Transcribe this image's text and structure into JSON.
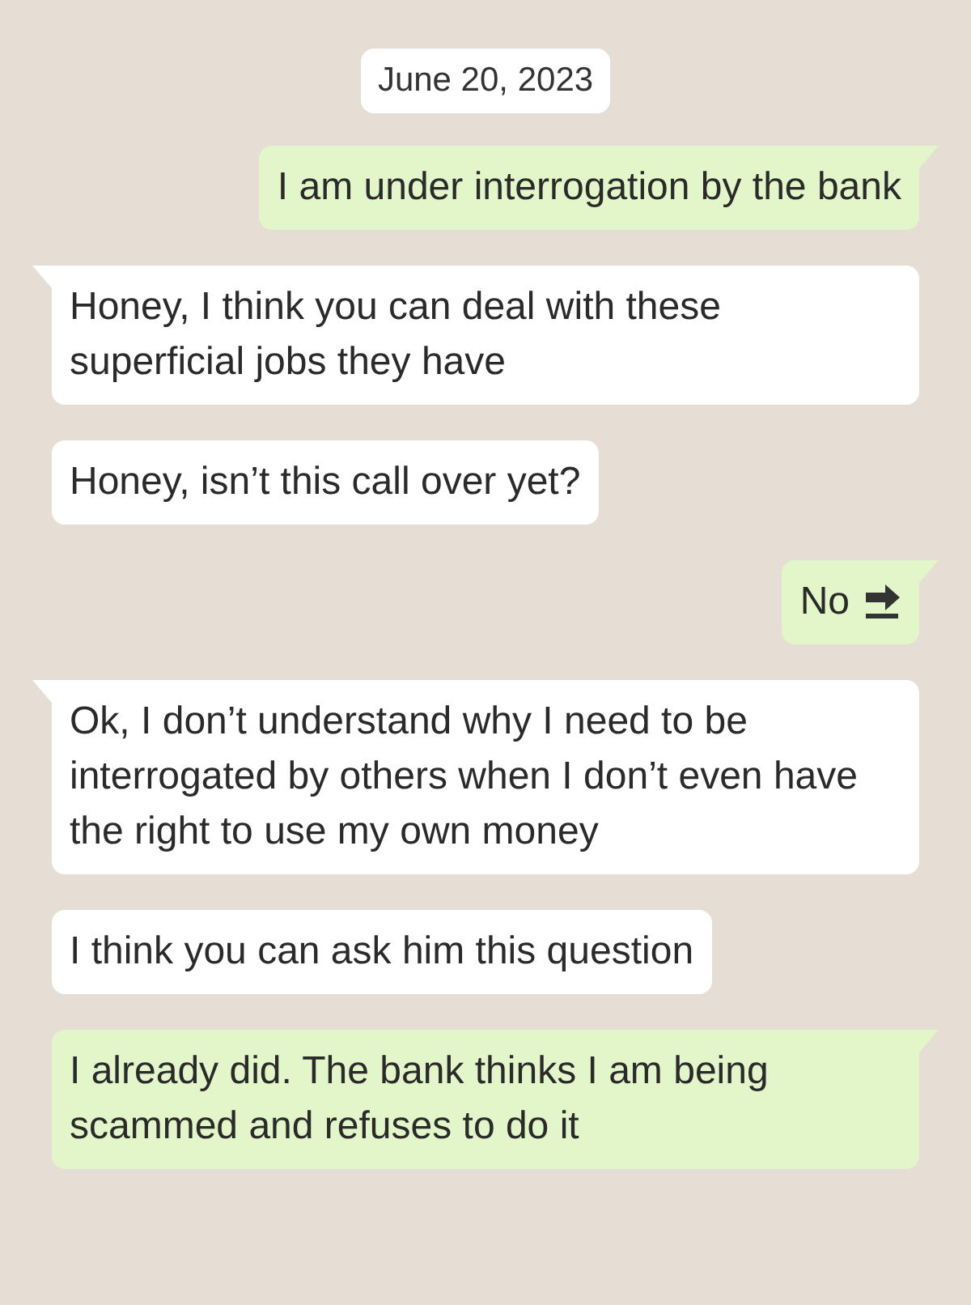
{
  "date": "June 20, 2023",
  "messages": [
    {
      "kind": "outgoing",
      "tail": true,
      "text": "I am under interrogation by the bank"
    },
    {
      "kind": "incoming",
      "tail": true,
      "text": "Honey, I think you can deal with these superficial jobs they have"
    },
    {
      "kind": "incoming",
      "tail": false,
      "text": "Honey, isn’t this call over yet?"
    },
    {
      "kind": "outgoing",
      "tail": true,
      "text": "No",
      "trailing_icon": true
    },
    {
      "kind": "incoming",
      "tail": true,
      "text": "Ok, I don’t understand why I need to be interrogated by others when I don’t even have the right to use my own money"
    },
    {
      "kind": "incoming",
      "tail": false,
      "text": "I think you can ask him this question"
    },
    {
      "kind": "outgoing",
      "tail": true,
      "text": "I already did. The bank thinks I am being scammed and refuses to do it"
    }
  ]
}
